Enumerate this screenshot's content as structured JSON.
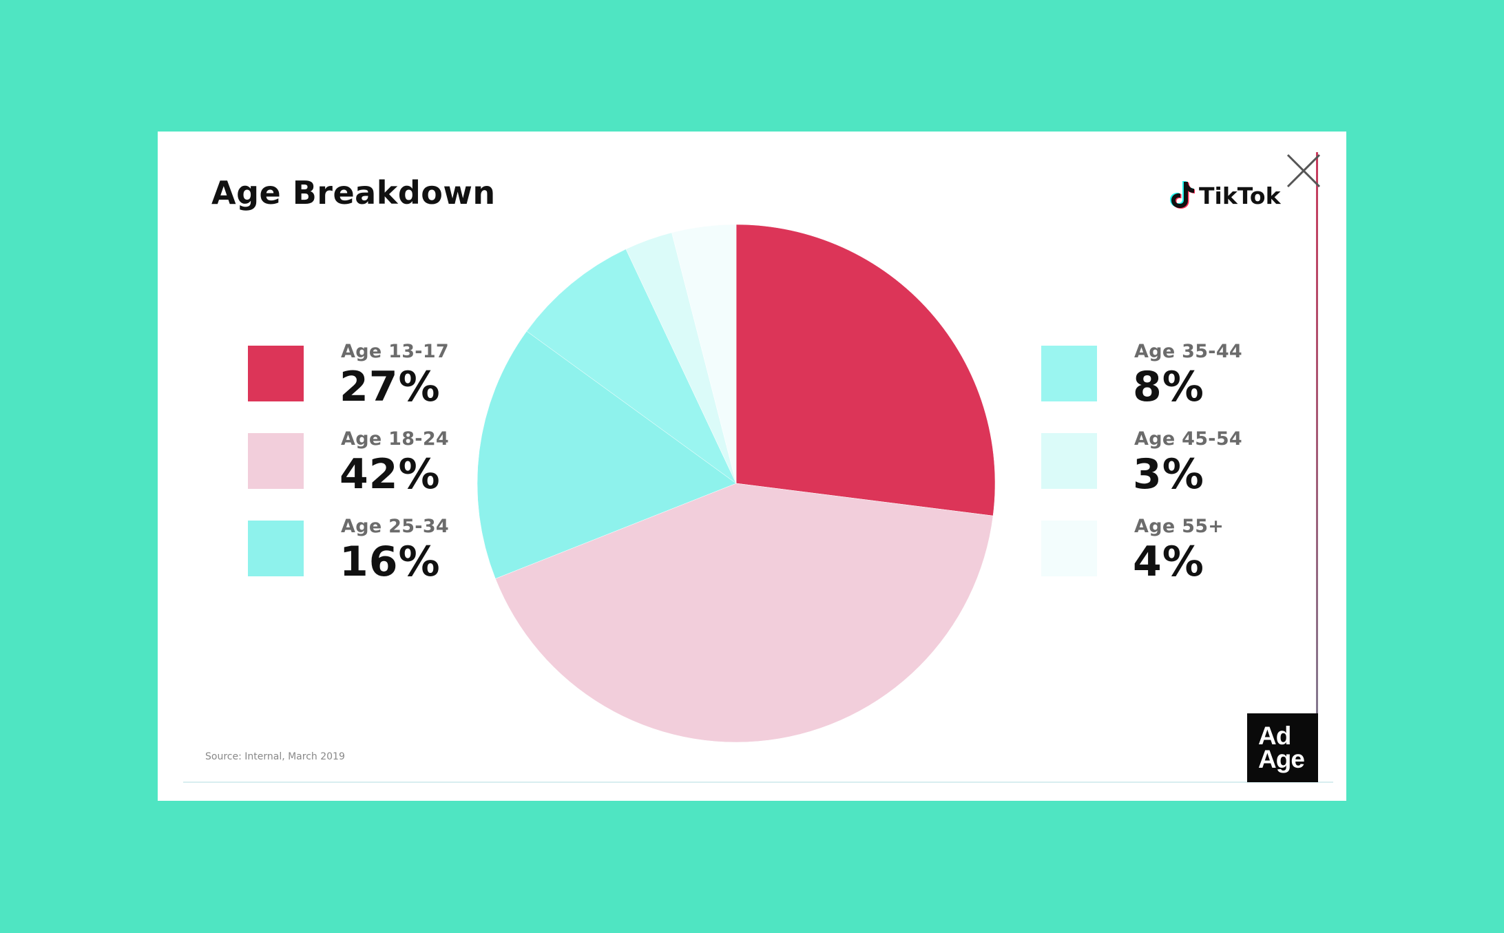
{
  "title": "Age Breakdown",
  "brand": {
    "name": "TikTok",
    "icon": "tiktok-note-icon"
  },
  "close_icon": "close-icon",
  "source": "Source: Internal, March 2019",
  "publisher": {
    "line1": "Ad",
    "line2": "Age"
  },
  "colors": {
    "background": "#4fe5c2",
    "age_13_17": "#dc3558",
    "age_18_24": "#f2cedb",
    "age_25_34": "#8ef2ec",
    "age_35_44": "#9af5f0",
    "age_45_54": "#dbfbf9",
    "age_55_plus": "#f3fdfd"
  },
  "chart_data": {
    "type": "pie",
    "title": "Age Breakdown",
    "categories": [
      "Age 13-17",
      "Age 18-24",
      "Age 25-34",
      "Age 35-44",
      "Age 45-54",
      "Age 55+"
    ],
    "values": [
      27,
      42,
      16,
      8,
      3,
      4
    ],
    "value_labels": [
      "27%",
      "42%",
      "16%",
      "8%",
      "3%",
      "4%"
    ],
    "colors": [
      "#dc3558",
      "#f2cedb",
      "#8ef2ec",
      "#9af5f0",
      "#dbfbf9",
      "#f3fdfd"
    ],
    "start_angle_deg": 0,
    "direction": "clockwise",
    "legend": "left-and-right"
  }
}
